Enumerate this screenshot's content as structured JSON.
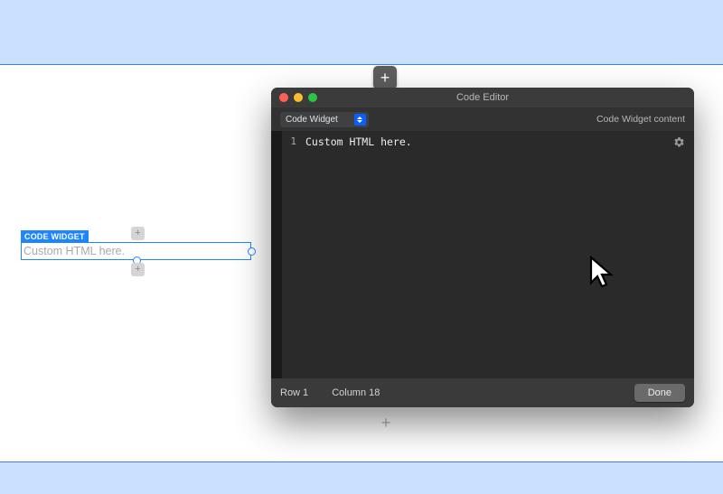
{
  "canvas": {
    "selected_widget_label": "CODE WIDGET",
    "selected_widget_text": "Custom HTML here."
  },
  "editor": {
    "title": "Code Editor",
    "dropdown": {
      "selected": "Code Widget"
    },
    "right_header": "Code Widget content",
    "line_number": "1",
    "code": "Custom HTML here.",
    "status": {
      "row": "Row 1",
      "col": "Column  18"
    },
    "done_label": "Done"
  },
  "icons": {
    "gear": "gear-icon",
    "plus": "plus-icon",
    "cursor": "cursor-icon"
  }
}
